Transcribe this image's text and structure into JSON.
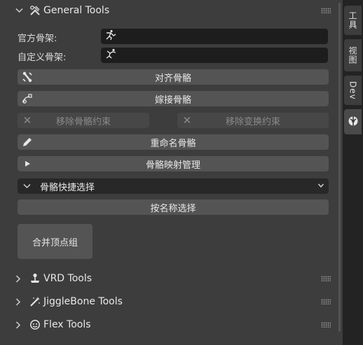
{
  "general_tools": {
    "title": "General Tools",
    "official_rig_label": "官方骨架:",
    "custom_rig_label": "自定义骨架:",
    "align_bones": "对齐骨骼",
    "graft_bones": "嫁接骨骼",
    "remove_bone_constraints": "移除骨骼约束",
    "remove_transform_constraints": "移除变换约束",
    "rename_bones": "重命名骨骼",
    "bone_mapping": "骨骼映射管理",
    "quick_select": "骨骼快捷选择",
    "select_by_name": "按名称选择",
    "merge_vertex_groups": "合并顶点组"
  },
  "sections": [
    {
      "title": "VRD Tools",
      "icon": "joystick-icon"
    },
    {
      "title": "JiggleBone Tools",
      "icon": "magic-wand-icon"
    },
    {
      "title": "Flex Tools",
      "icon": "face-icon"
    }
  ],
  "tabs": [
    "工具",
    "视图",
    "Dev"
  ]
}
